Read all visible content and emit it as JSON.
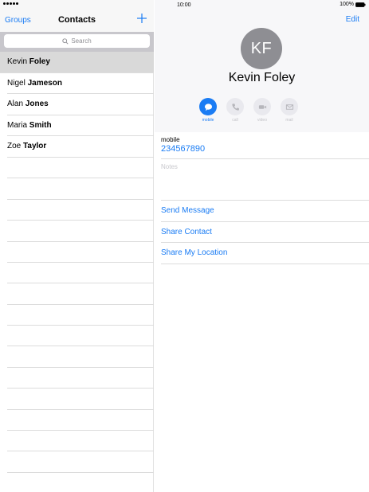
{
  "status_bar": {
    "time": "10:00",
    "battery": "100%"
  },
  "list_nav": {
    "groups_label": "Groups",
    "title": "Contacts",
    "add_icon": "plus-icon"
  },
  "search": {
    "placeholder": "Search",
    "icon": "search-icon"
  },
  "contacts": [
    {
      "first": "Kevin",
      "last": "Foley",
      "selected": true
    },
    {
      "first": "Nigel",
      "last": "Jameson",
      "selected": false
    },
    {
      "first": "Alan",
      "last": "Jones",
      "selected": false
    },
    {
      "first": "Maria",
      "last": "Smith",
      "selected": false
    },
    {
      "first": "Zoe",
      "last": "Taylor",
      "selected": false
    }
  ],
  "detail": {
    "edit_label": "Edit",
    "initials": "KF",
    "name": "Kevin Foley",
    "actions": [
      {
        "label": "mobile",
        "icon": "message-icon",
        "active": true
      },
      {
        "label": "call",
        "icon": "phone-icon",
        "active": false
      },
      {
        "label": "video",
        "icon": "video-icon",
        "active": false
      },
      {
        "label": "mail",
        "icon": "mail-icon",
        "active": false
      }
    ],
    "phone_label": "mobile",
    "phone_number": "234567890",
    "notes_label": "Notes",
    "links": [
      "Send Message",
      "Share Contact",
      "Share My Location"
    ]
  },
  "colors": {
    "accent": "#1a7cf4",
    "avatar": "#8e8e93",
    "selected_row": "#d9d9d9"
  }
}
